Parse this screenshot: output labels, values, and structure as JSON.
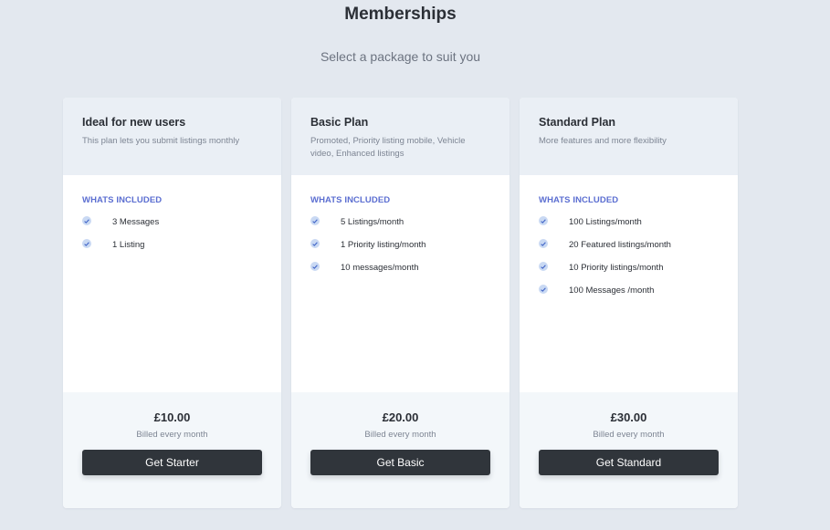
{
  "header": {
    "title": "Memberships",
    "subtitle": "Select a package to suit you"
  },
  "colors": {
    "page_bg": "#e3e8ef",
    "card_head_bg": "#eaeff5",
    "accent": "#5b6ed1",
    "button_bg": "#30353b"
  },
  "plans": [
    {
      "name": "Ideal for new users",
      "description": "This plan lets you submit listings monthly",
      "included_label": "WHATS INCLUDED",
      "features": [
        "3 Messages",
        "1 Listing"
      ],
      "price": "£10.00",
      "billing": "Billed every month",
      "button_label": "Get Starter"
    },
    {
      "name": "Basic Plan",
      "description": "Promoted, Priority listing mobile, Vehicle video, Enhanced listings",
      "included_label": "WHATS INCLUDED",
      "features": [
        "5 Listings/month",
        "1 Priority listing/month",
        "10 messages/month"
      ],
      "price": "£20.00",
      "billing": "Billed every month",
      "button_label": "Get Basic"
    },
    {
      "name": "Standard Plan",
      "description": "More features and more flexibility",
      "included_label": "WHATS INCLUDED",
      "features": [
        "100 Listings/month",
        "20 Featured listings/month",
        "10 Priority listings/month",
        "100 Messages /month"
      ],
      "price": "£30.00",
      "billing": "Billed every month",
      "button_label": "Get Standard"
    }
  ],
  "icons": {
    "feature": "check-icon"
  }
}
